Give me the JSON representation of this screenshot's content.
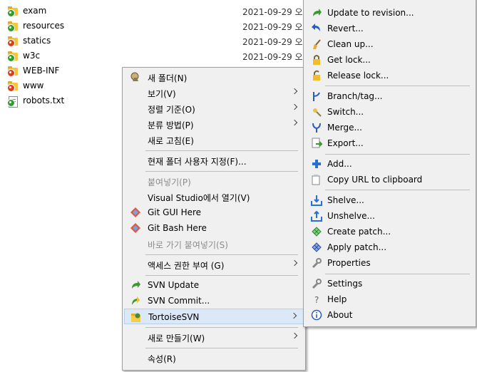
{
  "files": [
    {
      "name": "exam",
      "date": "2021-09-29 오",
      "type": "folder",
      "status": "ok"
    },
    {
      "name": "resources",
      "date": "2021-09-29 오",
      "type": "folder",
      "status": "ok"
    },
    {
      "name": "statics",
      "date": "2021-09-29 오",
      "type": "folder",
      "status": "mod"
    },
    {
      "name": "w3c",
      "date": "2021-09-29 오",
      "type": "folder",
      "status": "ok"
    },
    {
      "name": "WEB-INF",
      "date": "2021-09-29 오",
      "type": "folder",
      "status": "mod"
    },
    {
      "name": "www",
      "date": "2021-09-29 오",
      "type": "folder",
      "status": "mod"
    },
    {
      "name": "robots.txt",
      "date": "",
      "type": "file",
      "status": "ok"
    }
  ],
  "context_menu": {
    "new_folder": "새 폴더(N)",
    "view": "보기(V)",
    "sort_by": "정렬 기준(O)",
    "group_by": "분류 방법(P)",
    "refresh": "새로 고침(E)",
    "customize": "현재 폴더 사용자 지정(F)...",
    "paste": "붙여넣기(P)",
    "open_vs": "Visual Studio에서 열기(V)",
    "git_gui": "Git GUI Here",
    "git_bash": "Git Bash Here",
    "paste_shortcut": "바로 가기 붙여넣기(S)",
    "give_access": "액세스 권한 부여 (G)",
    "svn_update": "SVN Update",
    "svn_commit": "SVN Commit...",
    "tortoise": "TortoiseSVN",
    "new": "새로 만들기(W)",
    "properties": "속성(R)"
  },
  "tortoise_menu": {
    "update_to_revision": "Update to revision...",
    "revert": "Revert...",
    "cleanup": "Clean up...",
    "get_lock": "Get lock...",
    "release_lock": "Release lock...",
    "branch_tag": "Branch/tag...",
    "switch": "Switch...",
    "merge": "Merge...",
    "export": "Export...",
    "add": "Add...",
    "copy_url": "Copy URL to clipboard",
    "shelve": "Shelve...",
    "unshelve": "Unshelve...",
    "create_patch": "Create patch...",
    "apply_patch": "Apply patch...",
    "properties": "Properties",
    "settings": "Settings",
    "help": "Help",
    "about": "About"
  }
}
